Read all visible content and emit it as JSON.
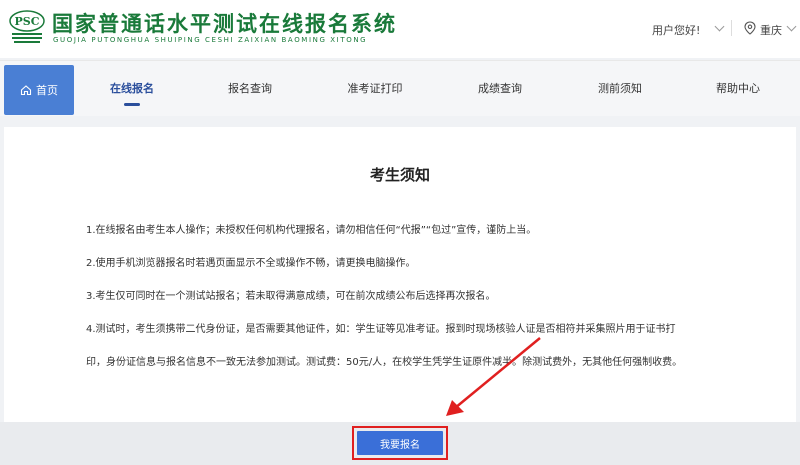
{
  "header": {
    "logo_text": "PSC",
    "title": "国家普通话水平测试在线报名系统",
    "subtitle": "GUOJIA PUTONGHUA SHUIPING CESHI ZAIXIAN BAOMING XITONG",
    "user_greeting": "用户您好!",
    "location": "重庆"
  },
  "nav": {
    "home": "首页",
    "items": [
      {
        "label": "在线报名"
      },
      {
        "label": "报名查询"
      },
      {
        "label": "准考证打印"
      },
      {
        "label": "成绩查询"
      },
      {
        "label": "测前须知"
      },
      {
        "label": "帮助中心"
      }
    ]
  },
  "notice": {
    "title": "考生须知",
    "paragraphs": [
      "1.在线报名由考生本人操作；未授权任何机构代理报名，请勿相信任何“代报”“包过”宣传，谨防上当。",
      "2.使用手机浏览器报名时若遇页面显示不全或操作不畅，请更换电脑操作。",
      "3.考生仅可同时在一个测试站报名；若未取得满意成绩，可在前次成绩公布后选择再次报名。",
      "4.测试时，考生须携带二代身份证，是否需要其他证件，如：学生证等见准考证。报到时现场核验人证是否相符并采集照片用于证书打",
      "印，身份证信息与报名信息不一致无法参加测试。测试费：50元/人，在校学生凭学生证原件减半。除测试费外，无其他任何强制收费。"
    ]
  },
  "apply_button": "我要报名",
  "colors": {
    "brand_green": "#1a7a3a",
    "nav_active": "#2b4f9c",
    "button_blue": "#3a6fd8",
    "highlight_red": "#e02020"
  }
}
